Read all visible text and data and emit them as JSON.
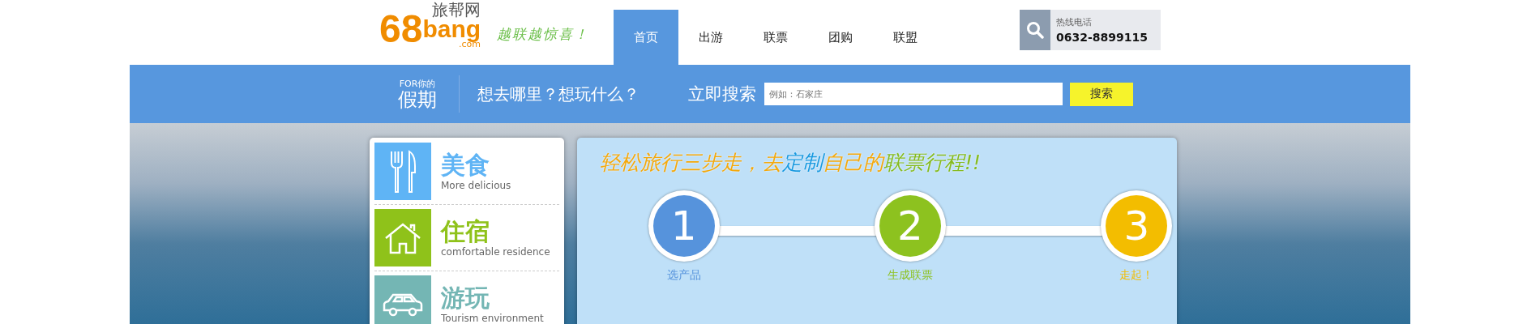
{
  "logo": {
    "digits": "68",
    "word": "bang",
    "chinese": "旅帮网",
    "domain": ".com"
  },
  "slogan": "越联越惊喜！",
  "nav": [
    {
      "label": "首页",
      "selected": true
    },
    {
      "label": "出游",
      "selected": false
    },
    {
      "label": "联票",
      "selected": false
    },
    {
      "label": "团购",
      "selected": false
    },
    {
      "label": "联盟",
      "selected": false
    }
  ],
  "hotline": {
    "label": "热线电话",
    "number": "0632-8899115"
  },
  "search_bar": {
    "for_label": "FOR你的",
    "holiday": "假期",
    "question": "想去哪里？想玩什么？",
    "prompt": "立即搜索",
    "placeholder": "例如：石家庄",
    "button": "搜索"
  },
  "categories": [
    {
      "kind": "food",
      "title": "美食",
      "subtitle": "More delicious",
      "color": "#5fb4f5"
    },
    {
      "kind": "lodging",
      "title": "住宿",
      "subtitle": "comfortable residence",
      "color": "#8fc21a"
    },
    {
      "kind": "travel",
      "title": "游玩",
      "subtitle": "Tourism environment",
      "color": "#74b6b4"
    }
  ],
  "steps_title": [
    {
      "text": "轻松旅行",
      "color": "#f3a80c"
    },
    {
      "text": "三步走",
      "color": "#f3a80c"
    },
    {
      "text": "，去",
      "color": "#f3a80c"
    },
    {
      "text": "定制",
      "color": "#1a9ae0"
    },
    {
      "text": "自己的",
      "color": "#f3a80c"
    },
    {
      "text": "联票行程",
      "color": "#86bb21"
    },
    {
      "text": "!!",
      "color": "#86bb21"
    }
  ],
  "steps": [
    {
      "number": "1",
      "label": "选产品",
      "color": "#5693dc"
    },
    {
      "number": "2",
      "label": "生成联票",
      "color": "#8dc21f"
    },
    {
      "number": "3",
      "label": "走起！",
      "color": "#f3bd00"
    }
  ]
}
